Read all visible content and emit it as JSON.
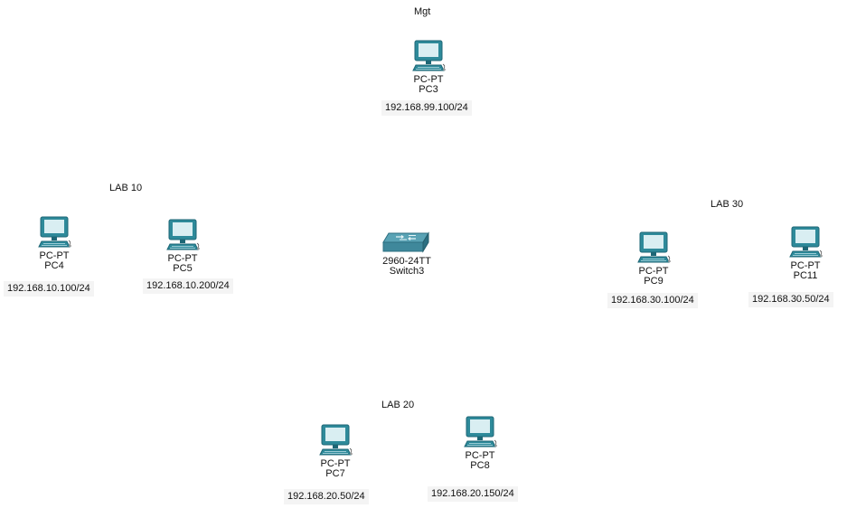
{
  "colors": {
    "monitor_frame": "#2e8a9a",
    "monitor_frame_dark": "#1d6675",
    "screen": "#d9eef2",
    "switch_top": "#4b93a6",
    "switch_side": "#2c6f81"
  },
  "zones": {
    "mgt": "Mgt",
    "lab10": "LAB 10",
    "lab20": "LAB 20",
    "lab30": "LAB 30"
  },
  "devices": {
    "pc3": {
      "type": "PC-PT",
      "name": "PC3",
      "ip": "192.168.99.100/24",
      "icon": "pc-icon"
    },
    "pc4": {
      "type": "PC-PT",
      "name": "PC4",
      "ip": "192.168.10.100/24",
      "icon": "pc-icon"
    },
    "pc5": {
      "type": "PC-PT",
      "name": "PC5",
      "ip": "192.168.10.200/24",
      "icon": "pc-icon"
    },
    "pc7": {
      "type": "PC-PT",
      "name": "PC7",
      "ip": "192.168.20.50/24",
      "icon": "pc-icon"
    },
    "pc8": {
      "type": "PC-PT",
      "name": "PC8",
      "ip": "192.168.20.150/24",
      "icon": "pc-icon"
    },
    "pc9": {
      "type": "PC-PT",
      "name": "PC9",
      "ip": "192.168.30.100/24",
      "icon": "pc-icon"
    },
    "pc11": {
      "type": "PC-PT",
      "name": "PC11",
      "ip": "192.168.30.50/24",
      "icon": "pc-icon"
    },
    "switch3": {
      "type": "2960-24TT",
      "name": "Switch3",
      "icon": "switch-icon"
    }
  }
}
